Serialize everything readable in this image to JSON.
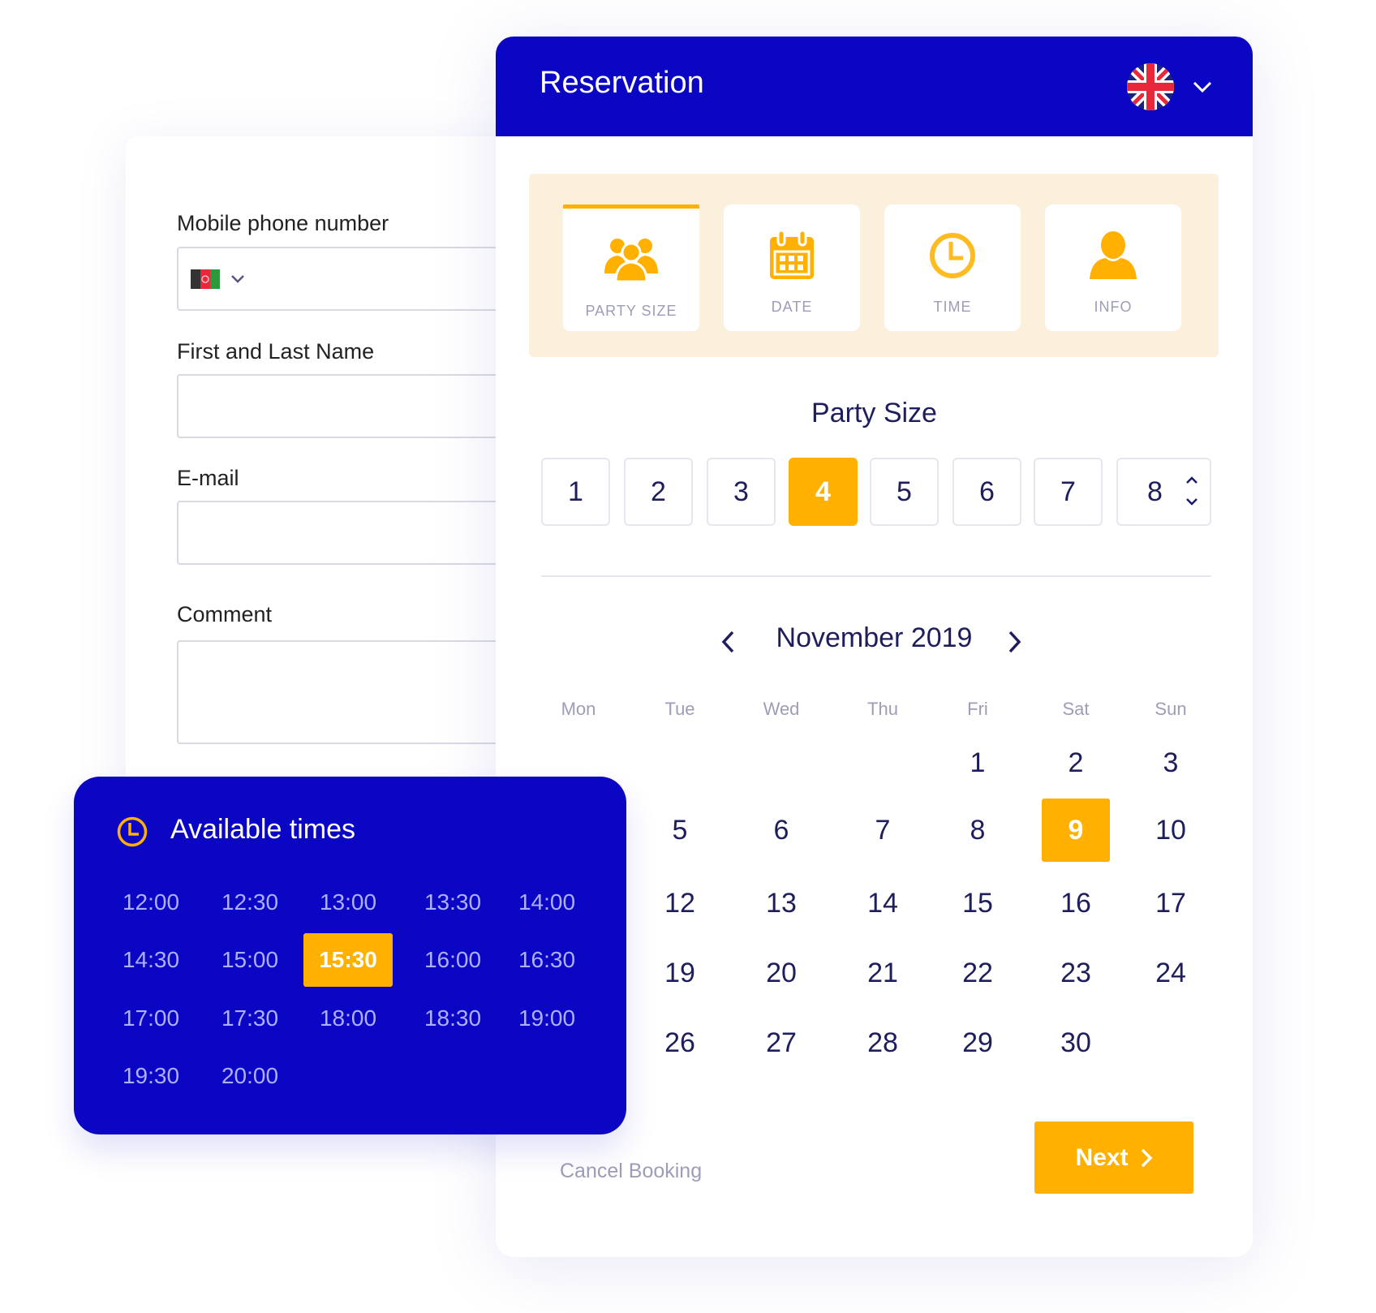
{
  "colors": {
    "brand_blue": "#0a06c4",
    "accent_orange": "#ffb000",
    "text_navy": "#1f1e5c",
    "muted": "#9d9db8"
  },
  "form": {
    "phone_label": "Mobile phone number",
    "phone_flag": "afghanistan-flag-icon",
    "name_label": "First and Last Name",
    "email_label": "E-mail",
    "comment_label": "Comment"
  },
  "header": {
    "title": "Reservation",
    "language_flag": "uk-flag-icon"
  },
  "steps": [
    {
      "label": "PARTY SIZE",
      "icon": "group-icon",
      "active": true
    },
    {
      "label": "DATE",
      "icon": "calendar-icon",
      "active": false
    },
    {
      "label": "TIME",
      "icon": "clock-icon",
      "active": false
    },
    {
      "label": "INFO",
      "icon": "user-icon",
      "active": false
    }
  ],
  "party_size": {
    "title": "Party Size",
    "options": [
      "1",
      "2",
      "3",
      "4",
      "5",
      "6",
      "7",
      "8"
    ],
    "selected": "4"
  },
  "calendar": {
    "month_label": "November 2019",
    "weekdays": [
      "Mon",
      "Tue",
      "Wed",
      "Thu",
      "Fri",
      "Sat",
      "Sun"
    ],
    "weeks": [
      [
        null,
        null,
        null,
        null,
        "1",
        "2",
        "3"
      ],
      [
        null,
        "5",
        "6",
        "7",
        "8",
        "9",
        "10"
      ],
      [
        null,
        "12",
        "13",
        "14",
        "15",
        "16",
        "17"
      ],
      [
        null,
        "19",
        "20",
        "21",
        "22",
        "23",
        "24"
      ],
      [
        null,
        "26",
        "27",
        "28",
        "29",
        "30",
        null
      ]
    ],
    "selected": "9"
  },
  "footer": {
    "cancel_label": "Cancel Booking",
    "next_label": "Next"
  },
  "times": {
    "title": "Available times",
    "slots": [
      "12:00",
      "12:30",
      "13:00",
      "13:30",
      "14:00",
      "14:30",
      "15:00",
      "15:30",
      "16:00",
      "16:30",
      "17:00",
      "17:30",
      "18:00",
      "18:30",
      "19:00",
      "19:30",
      "20:00"
    ],
    "selected": "15:30"
  }
}
